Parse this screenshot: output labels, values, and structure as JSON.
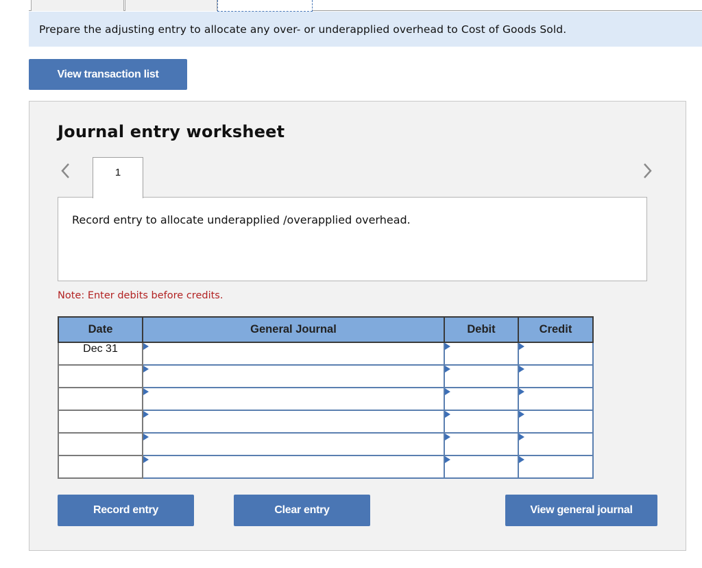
{
  "top_tabs": [
    {
      "label": "",
      "active": false
    },
    {
      "label": "",
      "active": false
    },
    {
      "label": "",
      "active": true
    }
  ],
  "instruction": "Prepare the adjusting entry to allocate any over- or underapplied overhead to Cost of Goods Sold.",
  "buttons": {
    "view_transaction_list": "View transaction list",
    "record_entry": "Record entry",
    "clear_entry": "Clear entry",
    "view_general_journal": "View general journal"
  },
  "worksheet": {
    "title": "Journal entry worksheet",
    "current_entry_tab": "1",
    "prev_icon": "chevron-left-icon",
    "next_icon": "chevron-right-icon",
    "entry_description": "Record entry to allocate underapplied /overapplied overhead.",
    "note": "Note: Enter debits before credits."
  },
  "journal": {
    "headers": {
      "date": "Date",
      "general_journal": "General Journal",
      "debit": "Debit",
      "credit": "Credit"
    },
    "rows": [
      {
        "date": "Dec 31",
        "account": "",
        "debit": "",
        "credit": ""
      },
      {
        "date": "",
        "account": "",
        "debit": "",
        "credit": ""
      },
      {
        "date": "",
        "account": "",
        "debit": "",
        "credit": ""
      },
      {
        "date": "",
        "account": "",
        "debit": "",
        "credit": ""
      },
      {
        "date": "",
        "account": "",
        "debit": "",
        "credit": ""
      },
      {
        "date": "",
        "account": "",
        "debit": "",
        "credit": ""
      }
    ]
  },
  "colors": {
    "button_bg": "#4a76b4",
    "header_bg": "#80aadc",
    "instruction_bg": "#dde9f7",
    "note_text": "#b22222"
  }
}
